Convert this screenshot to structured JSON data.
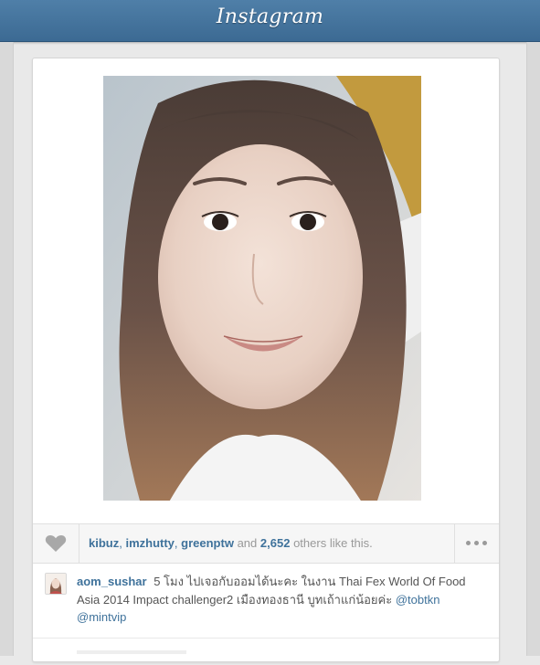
{
  "header": {
    "app_title": "Instagram"
  },
  "post": {
    "likes": {
      "users": [
        "kibuz",
        "imzhutty",
        "greenptw"
      ],
      "and_label": "and",
      "others_count": "2,652",
      "suffix": "others like this."
    },
    "caption": {
      "username": "aom_sushar",
      "text": "5 โมง ไปเจอกับออมได้นะคะ ในงาน Thai Fex World Of Food Asia 2014 Impact challenger2 เมืองทองธานี บูทเถ้าแก่น้อยค่ะ",
      "mentions": [
        "@tobtkn",
        "@mintvip"
      ]
    }
  },
  "colors": {
    "header_blue": "#3f6e98",
    "link_blue": "#3f729b",
    "muted_text": "#999999"
  },
  "icons": [
    "heart-icon",
    "more-options-icon"
  ]
}
